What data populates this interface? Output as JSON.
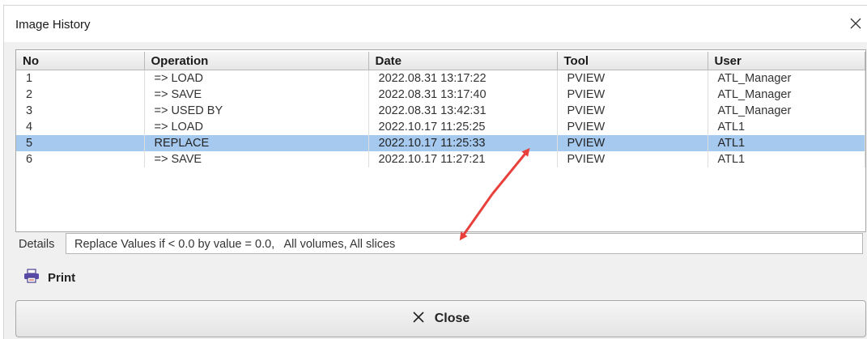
{
  "window": {
    "title": "Image History"
  },
  "table": {
    "columns": [
      "No",
      "Operation",
      "Date",
      "Tool",
      "User"
    ],
    "rows": [
      {
        "no": "1",
        "operation": "=> LOAD",
        "date": "2022.08.31 13:17:22",
        "tool": "PVIEW",
        "user": "ATL_Manager"
      },
      {
        "no": "2",
        "operation": "=> SAVE",
        "date": "2022.08.31 13:17:40",
        "tool": "PVIEW",
        "user": "ATL_Manager"
      },
      {
        "no": "3",
        "operation": "=> USED BY",
        "date": "2022.08.31 13:42:31",
        "tool": "PVIEW",
        "user": "ATL_Manager"
      },
      {
        "no": "4",
        "operation": "=> LOAD",
        "date": "2022.10.17 11:25:25",
        "tool": "PVIEW",
        "user": "ATL1"
      },
      {
        "no": "5",
        "operation": "REPLACE",
        "date": "2022.10.17 11:25:33",
        "tool": "PVIEW",
        "user": "ATL1"
      },
      {
        "no": "6",
        "operation": "=> SAVE",
        "date": "2022.10.17 11:27:21",
        "tool": "PVIEW",
        "user": "ATL1"
      }
    ],
    "selected_row": "5"
  },
  "details": {
    "label": "Details",
    "value": "Replace Values if < 0.0 by value = 0.0,   All volumes, All slices"
  },
  "actions": {
    "print_label": "Print",
    "close_label": "Close"
  },
  "colors": {
    "selection": "#a6c9ef",
    "annotation_arrow": "#e8413b"
  },
  "icons": {
    "close": "close-icon",
    "print": "printer-icon",
    "button_close": "x-icon"
  }
}
